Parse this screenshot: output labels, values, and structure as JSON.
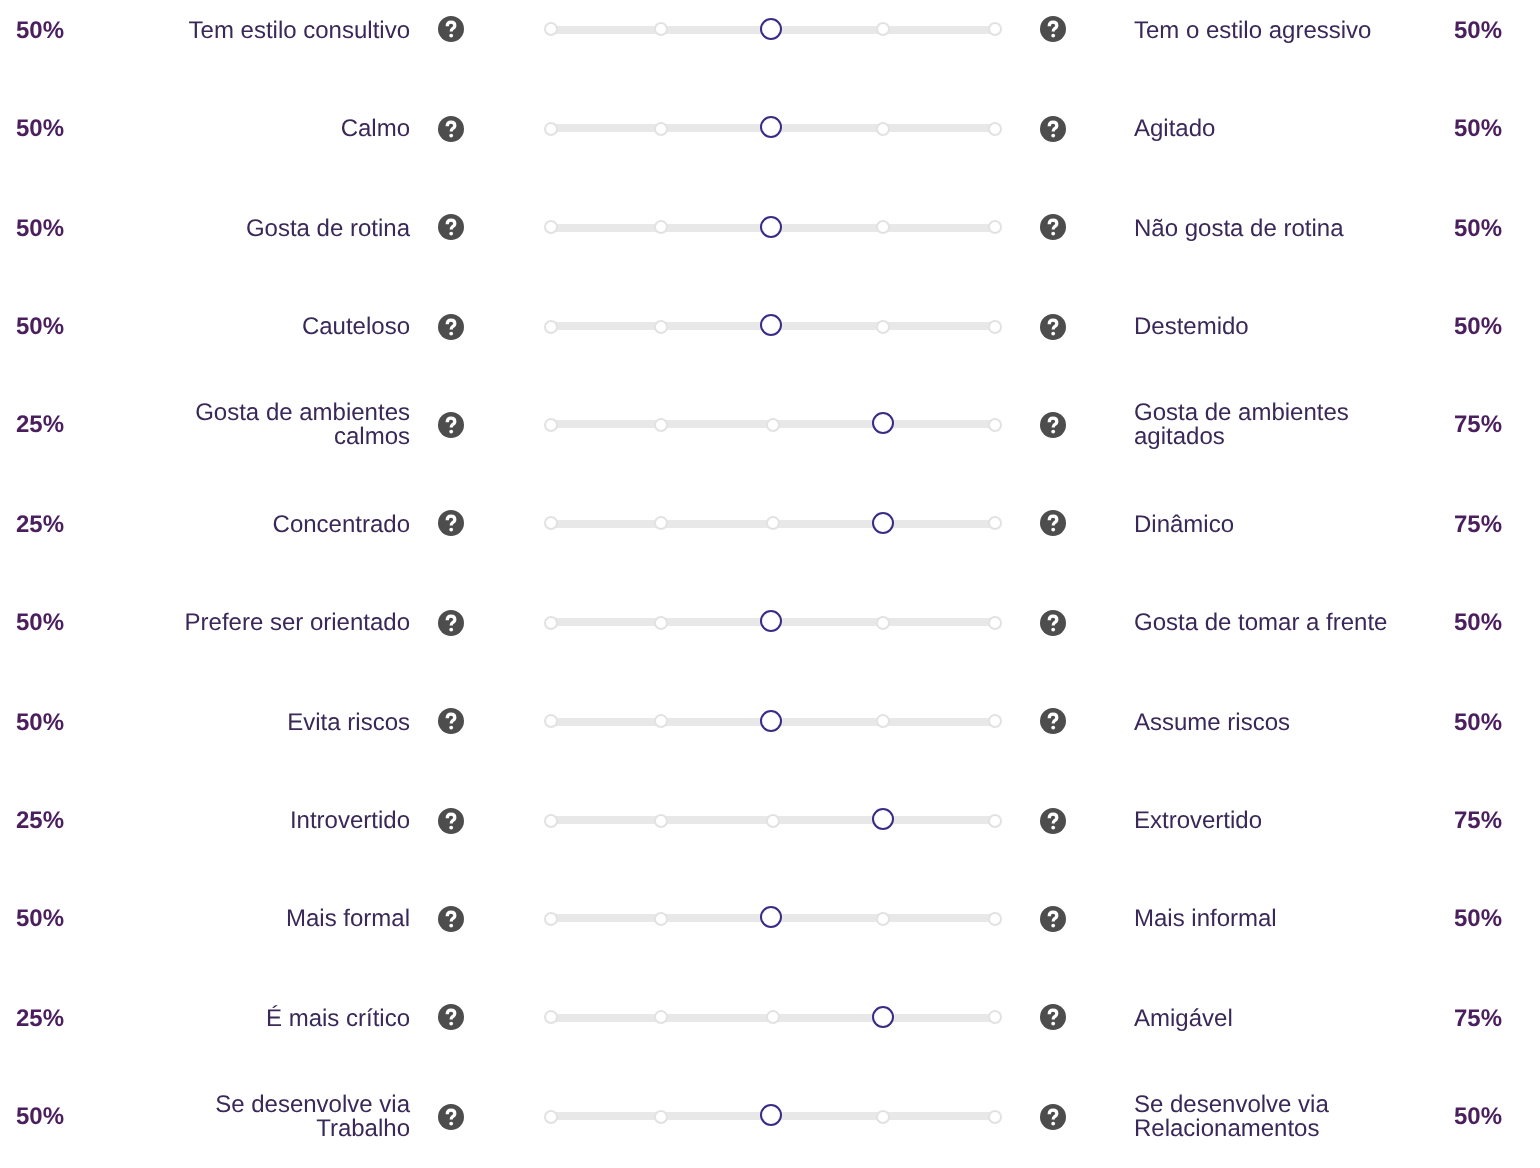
{
  "traits": [
    {
      "left_percent": "50%",
      "left_label": "Tem estilo consultivo",
      "level": 0.5,
      "right_label": "Tem o estilo agressivo",
      "right_percent": "50%"
    },
    {
      "left_percent": "50%",
      "left_label": "Calmo",
      "level": 0.5,
      "right_label": "Agitado",
      "right_percent": "50%"
    },
    {
      "left_percent": "50%",
      "left_label": "Gosta de rotina",
      "level": 0.5,
      "right_label": "Não gosta de rotina",
      "right_percent": "50%"
    },
    {
      "left_percent": "50%",
      "left_label": "Cauteloso",
      "level": 0.5,
      "right_label": "Destemido",
      "right_percent": "50%"
    },
    {
      "left_percent": "25%",
      "left_label": "Gosta de ambientes calmos",
      "level": 0.75,
      "right_label": "Gosta de ambientes agitados",
      "right_percent": "75%"
    },
    {
      "left_percent": "25%",
      "left_label": "Concentrado",
      "level": 0.75,
      "right_label": "Dinâmico",
      "right_percent": "75%"
    },
    {
      "left_percent": "50%",
      "left_label": "Prefere ser orientado",
      "level": 0.5,
      "right_label": "Gosta de tomar a frente",
      "right_percent": "50%"
    },
    {
      "left_percent": "50%",
      "left_label": "Evita riscos",
      "level": 0.5,
      "right_label": "Assume riscos",
      "right_percent": "50%"
    },
    {
      "left_percent": "25%",
      "left_label": "Introvertido",
      "level": 0.75,
      "right_label": "Extrovertido",
      "right_percent": "75%"
    },
    {
      "left_percent": "50%",
      "left_label": "Mais formal",
      "level": 0.5,
      "right_label": "Mais informal",
      "right_percent": "50%"
    },
    {
      "left_percent": "25%",
      "left_label": "É mais crítico",
      "level": 0.75,
      "right_label": "Amigável",
      "right_percent": "75%"
    },
    {
      "left_percent": "50%",
      "left_label": "Se desenvolve via Trabalho",
      "level": 0.5,
      "right_label": "Se desenvolve via Relacionamentos",
      "right_percent": "50%"
    }
  ]
}
